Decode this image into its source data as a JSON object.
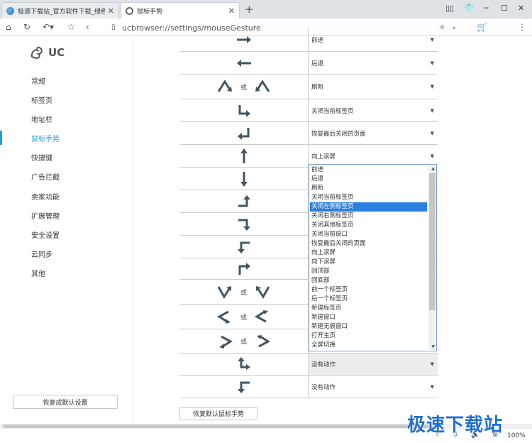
{
  "browser": {
    "tabs": [
      {
        "title": "极速下载站_官方软件下载_绿色",
        "close": "✕"
      },
      {
        "title": "鼠标手势",
        "close": "✕"
      }
    ],
    "new_tab": "+",
    "url": "ucbrowser://settings/mouseGesture",
    "zoom": "100%",
    "accent_color": "#2a9ae0"
  },
  "sidebar": {
    "logo_text": "UC",
    "items": [
      {
        "label": "常规"
      },
      {
        "label": "标签页"
      },
      {
        "label": "地址栏"
      },
      {
        "label": "鼠标手势"
      },
      {
        "label": "快捷键"
      },
      {
        "label": "广告拦截"
      },
      {
        "label": "卖家功能"
      },
      {
        "label": "扩展管理"
      },
      {
        "label": "安全设置"
      },
      {
        "label": "云同步"
      },
      {
        "label": "其他"
      }
    ],
    "active_item": "鼠标手势",
    "reset_button": "恢复成默认设置"
  },
  "gestures": {
    "or_text": "或",
    "rows": [
      {
        "action": "前进",
        "icon": "arrow-right-icon"
      },
      {
        "action": "后退",
        "icon": "arrow-left-icon"
      },
      {
        "action": "刷新",
        "icon": "up-down-icon"
      },
      {
        "action": "关闭当前标签页",
        "icon": "down-right-icon"
      },
      {
        "action": "恢复最后关闭的页面",
        "icon": "up-left-icon"
      },
      {
        "action": "向上滚屏",
        "icon": "arrow-up-icon"
      },
      {
        "action": "",
        "icon": "arrow-down-icon"
      },
      {
        "action": "",
        "icon": "right-up-icon"
      },
      {
        "action": "",
        "icon": "right-down-icon"
      },
      {
        "action": "",
        "icon": "up-left-down-icon"
      },
      {
        "action": "",
        "icon": "up-right-icon"
      },
      {
        "action": "",
        "icon": "down-up-icon"
      },
      {
        "action": "",
        "icon": "left-right-icon"
      },
      {
        "action": "",
        "icon": "right-left-icon"
      },
      {
        "action": "没有动作",
        "icon": "up-right-turn-icon"
      },
      {
        "action": "没有动作",
        "icon": "down-left-turn-icon"
      }
    ],
    "reset_button": "恢复默认鼠标手势"
  },
  "dropdown": {
    "options": [
      "前进",
      "后退",
      "刷新",
      "关闭当前标签页",
      "关闭左侧标签页",
      "关闭右侧标签页",
      "关闭其他标签页",
      "关闭当前窗口",
      "恢复最后关闭的页面",
      "向上滚屏",
      "向下滚屏",
      "回顶部",
      "回底部",
      "前一个标签页",
      "后一个标签页",
      "新建标签页",
      "新建窗口",
      "新建无痕窗口",
      "打开主页",
      "全屏切换"
    ],
    "selected": "关闭左侧标签页"
  },
  "watermark": "极速下载站"
}
